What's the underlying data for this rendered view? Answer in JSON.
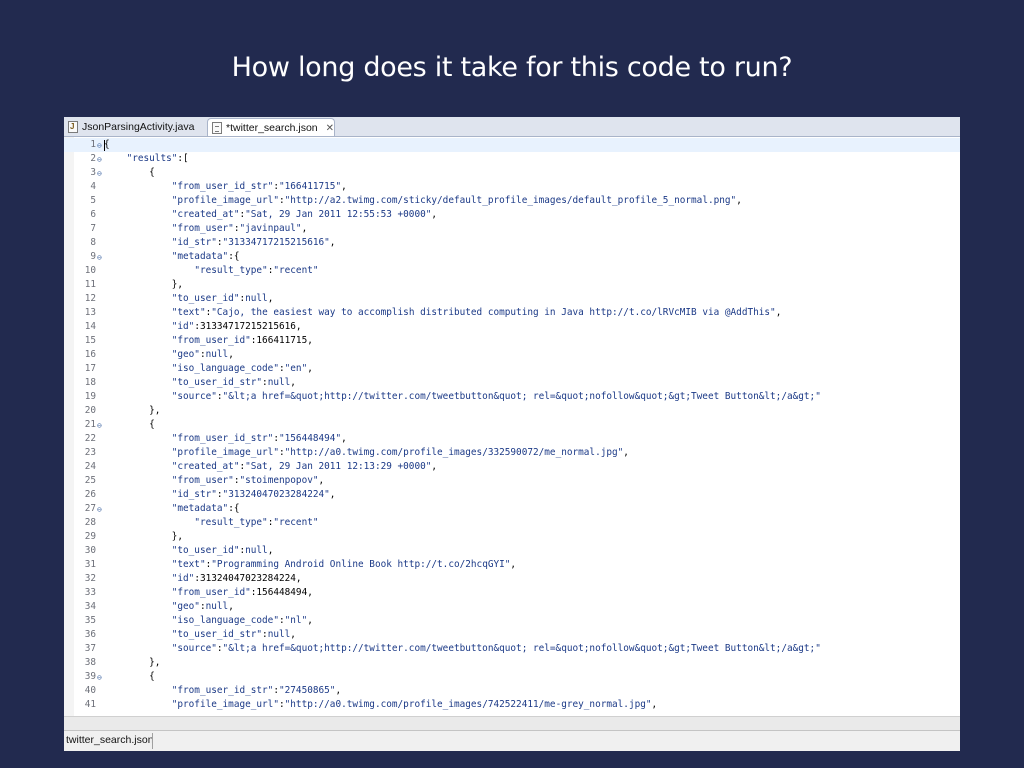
{
  "slide": {
    "title": "How long does it take for this code to run?"
  },
  "tabs": [
    {
      "label": "JsonParsingActivity.java",
      "icon": "java-file-icon"
    },
    {
      "label": "*twitter_search.json",
      "icon": "json-file-icon",
      "close": "✕"
    }
  ],
  "status": {
    "file_name": "twitter_search.json"
  },
  "lines": [
    {
      "n": "1",
      "fold": "⊖",
      "tokens": [
        [
          "p",
          "{"
        ]
      ]
    },
    {
      "n": "2",
      "fold": "⊖",
      "tokens": [
        [
          "p",
          "    "
        ],
        [
          "k",
          "\"results\""
        ],
        [
          "p",
          ":["
        ]
      ]
    },
    {
      "n": "3",
      "fold": "⊖",
      "tokens": [
        [
          "p",
          "        {"
        ]
      ]
    },
    {
      "n": "4",
      "fold": "",
      "tokens": [
        [
          "p",
          "            "
        ],
        [
          "k",
          "\"from_user_id_str\""
        ],
        [
          "p",
          ":"
        ],
        [
          "s",
          "\"166411715\""
        ],
        [
          "p",
          ","
        ]
      ]
    },
    {
      "n": "5",
      "fold": "",
      "tokens": [
        [
          "p",
          "            "
        ],
        [
          "k",
          "\"profile_image_url\""
        ],
        [
          "p",
          ":"
        ],
        [
          "s",
          "\"http://a2.twimg.com/sticky/default_profile_images/default_profile_5_normal.png\""
        ],
        [
          "p",
          ","
        ]
      ]
    },
    {
      "n": "6",
      "fold": "",
      "tokens": [
        [
          "p",
          "            "
        ],
        [
          "k",
          "\"created_at\""
        ],
        [
          "p",
          ":"
        ],
        [
          "s",
          "\"Sat, 29 Jan 2011 12:55:53 +0000\""
        ],
        [
          "p",
          ","
        ]
      ]
    },
    {
      "n": "7",
      "fold": "",
      "tokens": [
        [
          "p",
          "            "
        ],
        [
          "k",
          "\"from_user\""
        ],
        [
          "p",
          ":"
        ],
        [
          "s",
          "\"javinpaul\""
        ],
        [
          "p",
          ","
        ]
      ]
    },
    {
      "n": "8",
      "fold": "",
      "tokens": [
        [
          "p",
          "            "
        ],
        [
          "k",
          "\"id_str\""
        ],
        [
          "p",
          ":"
        ],
        [
          "s",
          "\"31334717215215616\""
        ],
        [
          "p",
          ","
        ]
      ]
    },
    {
      "n": "9",
      "fold": "⊖",
      "tokens": [
        [
          "p",
          "            "
        ],
        [
          "k",
          "\"metadata\""
        ],
        [
          "p",
          ":{"
        ]
      ]
    },
    {
      "n": "10",
      "fold": "",
      "tokens": [
        [
          "p",
          "                "
        ],
        [
          "k",
          "\"result_type\""
        ],
        [
          "p",
          ":"
        ],
        [
          "s",
          "\"recent\""
        ]
      ]
    },
    {
      "n": "11",
      "fold": "",
      "tokens": [
        [
          "p",
          "            },"
        ]
      ]
    },
    {
      "n": "12",
      "fold": "",
      "tokens": [
        [
          "p",
          "            "
        ],
        [
          "k",
          "\"to_user_id\""
        ],
        [
          "p",
          ":"
        ],
        [
          "s",
          "null"
        ],
        [
          "p",
          ","
        ]
      ]
    },
    {
      "n": "13",
      "fold": "",
      "tokens": [
        [
          "p",
          "            "
        ],
        [
          "k",
          "\"text\""
        ],
        [
          "p",
          ":"
        ],
        [
          "s",
          "\"Cajo, the easiest way to accomplish distributed computing in Java http://t.co/lRVcMIB via @AddThis\""
        ],
        [
          "p",
          ","
        ]
      ]
    },
    {
      "n": "14",
      "fold": "",
      "tokens": [
        [
          "p",
          "            "
        ],
        [
          "k",
          "\"id\""
        ],
        [
          "p",
          ":31334717215215616,"
        ]
      ]
    },
    {
      "n": "15",
      "fold": "",
      "tokens": [
        [
          "p",
          "            "
        ],
        [
          "k",
          "\"from_user_id\""
        ],
        [
          "p",
          ":166411715,"
        ]
      ]
    },
    {
      "n": "16",
      "fold": "",
      "tokens": [
        [
          "p",
          "            "
        ],
        [
          "k",
          "\"geo\""
        ],
        [
          "p",
          ":"
        ],
        [
          "s",
          "null"
        ],
        [
          "p",
          ","
        ]
      ]
    },
    {
      "n": "17",
      "fold": "",
      "tokens": [
        [
          "p",
          "            "
        ],
        [
          "k",
          "\"iso_language_code\""
        ],
        [
          "p",
          ":"
        ],
        [
          "s",
          "\"en\""
        ],
        [
          "p",
          ","
        ]
      ]
    },
    {
      "n": "18",
      "fold": "",
      "tokens": [
        [
          "p",
          "            "
        ],
        [
          "k",
          "\"to_user_id_str\""
        ],
        [
          "p",
          ":"
        ],
        [
          "s",
          "null"
        ],
        [
          "p",
          ","
        ]
      ]
    },
    {
      "n": "19",
      "fold": "",
      "tokens": [
        [
          "p",
          "            "
        ],
        [
          "k",
          "\"source\""
        ],
        [
          "p",
          ":"
        ],
        [
          "s",
          "\"&lt;a href=&quot;http://twitter.com/tweetbutton&quot; rel=&quot;nofollow&quot;&gt;Tweet Button&lt;/a&gt;\""
        ]
      ]
    },
    {
      "n": "20",
      "fold": "",
      "tokens": [
        [
          "p",
          "        },"
        ]
      ]
    },
    {
      "n": "21",
      "fold": "⊖",
      "tokens": [
        [
          "p",
          "        {"
        ]
      ]
    },
    {
      "n": "22",
      "fold": "",
      "tokens": [
        [
          "p",
          "            "
        ],
        [
          "k",
          "\"from_user_id_str\""
        ],
        [
          "p",
          ":"
        ],
        [
          "s",
          "\"156448494\""
        ],
        [
          "p",
          ","
        ]
      ]
    },
    {
      "n": "23",
      "fold": "",
      "tokens": [
        [
          "p",
          "            "
        ],
        [
          "k",
          "\"profile_image_url\""
        ],
        [
          "p",
          ":"
        ],
        [
          "s",
          "\"http://a0.twimg.com/profile_images/332590072/me_normal.jpg\""
        ],
        [
          "p",
          ","
        ]
      ]
    },
    {
      "n": "24",
      "fold": "",
      "tokens": [
        [
          "p",
          "            "
        ],
        [
          "k",
          "\"created_at\""
        ],
        [
          "p",
          ":"
        ],
        [
          "s",
          "\"Sat, 29 Jan 2011 12:13:29 +0000\""
        ],
        [
          "p",
          ","
        ]
      ]
    },
    {
      "n": "25",
      "fold": "",
      "tokens": [
        [
          "p",
          "            "
        ],
        [
          "k",
          "\"from_user\""
        ],
        [
          "p",
          ":"
        ],
        [
          "s",
          "\"stoimenpopov\""
        ],
        [
          "p",
          ","
        ]
      ]
    },
    {
      "n": "26",
      "fold": "",
      "tokens": [
        [
          "p",
          "            "
        ],
        [
          "k",
          "\"id_str\""
        ],
        [
          "p",
          ":"
        ],
        [
          "s",
          "\"31324047023284224\""
        ],
        [
          "p",
          ","
        ]
      ]
    },
    {
      "n": "27",
      "fold": "⊖",
      "tokens": [
        [
          "p",
          "            "
        ],
        [
          "k",
          "\"metadata\""
        ],
        [
          "p",
          ":{"
        ]
      ]
    },
    {
      "n": "28",
      "fold": "",
      "tokens": [
        [
          "p",
          "                "
        ],
        [
          "k",
          "\"result_type\""
        ],
        [
          "p",
          ":"
        ],
        [
          "s",
          "\"recent\""
        ]
      ]
    },
    {
      "n": "29",
      "fold": "",
      "tokens": [
        [
          "p",
          "            },"
        ]
      ]
    },
    {
      "n": "30",
      "fold": "",
      "tokens": [
        [
          "p",
          "            "
        ],
        [
          "k",
          "\"to_user_id\""
        ],
        [
          "p",
          ":"
        ],
        [
          "s",
          "null"
        ],
        [
          "p",
          ","
        ]
      ]
    },
    {
      "n": "31",
      "fold": "",
      "tokens": [
        [
          "p",
          "            "
        ],
        [
          "k",
          "\"text\""
        ],
        [
          "p",
          ":"
        ],
        [
          "s",
          "\"Programming Android Online Book http://t.co/2hcqGYI\""
        ],
        [
          "p",
          ","
        ]
      ]
    },
    {
      "n": "32",
      "fold": "",
      "tokens": [
        [
          "p",
          "            "
        ],
        [
          "k",
          "\"id\""
        ],
        [
          "p",
          ":31324047023284224,"
        ]
      ]
    },
    {
      "n": "33",
      "fold": "",
      "tokens": [
        [
          "p",
          "            "
        ],
        [
          "k",
          "\"from_user_id\""
        ],
        [
          "p",
          ":156448494,"
        ]
      ]
    },
    {
      "n": "34",
      "fold": "",
      "tokens": [
        [
          "p",
          "            "
        ],
        [
          "k",
          "\"geo\""
        ],
        [
          "p",
          ":"
        ],
        [
          "s",
          "null"
        ],
        [
          "p",
          ","
        ]
      ]
    },
    {
      "n": "35",
      "fold": "",
      "tokens": [
        [
          "p",
          "            "
        ],
        [
          "k",
          "\"iso_language_code\""
        ],
        [
          "p",
          ":"
        ],
        [
          "s",
          "\"nl\""
        ],
        [
          "p",
          ","
        ]
      ]
    },
    {
      "n": "36",
      "fold": "",
      "tokens": [
        [
          "p",
          "            "
        ],
        [
          "k",
          "\"to_user_id_str\""
        ],
        [
          "p",
          ":"
        ],
        [
          "s",
          "null"
        ],
        [
          "p",
          ","
        ]
      ]
    },
    {
      "n": "37",
      "fold": "",
      "tokens": [
        [
          "p",
          "            "
        ],
        [
          "k",
          "\"source\""
        ],
        [
          "p",
          ":"
        ],
        [
          "s",
          "\"&lt;a href=&quot;http://twitter.com/tweetbutton&quot; rel=&quot;nofollow&quot;&gt;Tweet Button&lt;/a&gt;\""
        ]
      ]
    },
    {
      "n": "38",
      "fold": "",
      "tokens": [
        [
          "p",
          "        },"
        ]
      ]
    },
    {
      "n": "39",
      "fold": "⊖",
      "tokens": [
        [
          "p",
          "        {"
        ]
      ]
    },
    {
      "n": "40",
      "fold": "",
      "tokens": [
        [
          "p",
          "            "
        ],
        [
          "k",
          "\"from_user_id_str\""
        ],
        [
          "p",
          ":"
        ],
        [
          "s",
          "\"27450865\""
        ],
        [
          "p",
          ","
        ]
      ]
    },
    {
      "n": "41",
      "fold": "",
      "tokens": [
        [
          "p",
          "            "
        ],
        [
          "k",
          "\"profile_image_url\""
        ],
        [
          "p",
          ":"
        ],
        [
          "s",
          "\"http://a0.twimg.com/profile_images/742522411/me-grey_normal.jpg\""
        ],
        [
          "p",
          ","
        ]
      ]
    }
  ]
}
